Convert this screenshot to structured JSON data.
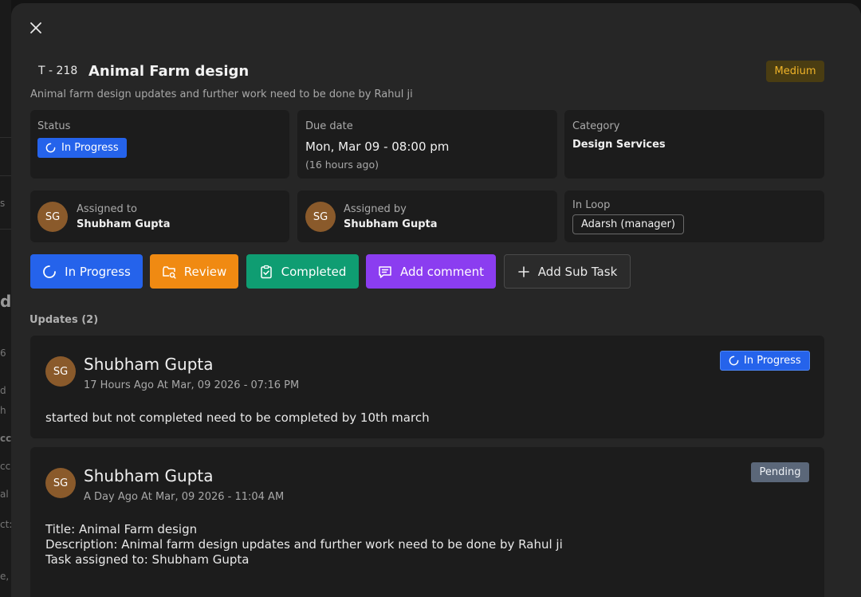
{
  "task": {
    "id": "T - 218",
    "title": "Animal Farm design",
    "priority": "Medium",
    "description": "Animal farm design updates and further work need to be done by Rahul ji"
  },
  "status": {
    "label": "Status",
    "value": "In Progress"
  },
  "due": {
    "label": "Due date",
    "value": "Mon, Mar 09 - 08:00 pm",
    "relative": "(16 hours ago)"
  },
  "category": {
    "label": "Category",
    "value": "Design Services"
  },
  "assigned_to": {
    "label": "Assigned to",
    "initials": "SG",
    "name": "Shubham Gupta"
  },
  "assigned_by": {
    "label": "Assigned by",
    "initials": "SG",
    "name": "Shubham Gupta"
  },
  "in_loop": {
    "label": "In Loop",
    "members": [
      "Adarsh (manager)"
    ]
  },
  "actions": {
    "in_progress": "In Progress",
    "review": "Review",
    "completed": "Completed",
    "add_comment": "Add comment",
    "add_sub_task": "Add Sub Task"
  },
  "updates": {
    "heading": "Updates (2)",
    "items": [
      {
        "initials": "SG",
        "author": "Shubham Gupta",
        "time": "17 Hours Ago At Mar, 09 2026 - 07:16 PM",
        "status": "In Progress",
        "lines": [
          "started but not completed need to be completed by 10th march"
        ]
      },
      {
        "initials": "SG",
        "author": "Shubham Gupta",
        "time": "A Day Ago At Mar, 09 2026 - 11:04 AM",
        "status": "Pending",
        "lines": [
          "Title: Animal Farm design",
          "Description: Animal farm design updates and further work need to be done by Rahul ji",
          "Task assigned to: Shubham Gupta"
        ]
      }
    ]
  },
  "background": {
    "fragments": [
      "s",
      "di",
      "6",
      "d",
      "h",
      "cc",
      "cc",
      "al",
      "ct:",
      "e,"
    ]
  },
  "colors": {
    "in_progress": "#2563eb",
    "review": "#f08a12",
    "completed": "#0f9d72",
    "comment": "#8b3df0",
    "priority_medium": "#f0b429",
    "pending": "#5b6779"
  }
}
